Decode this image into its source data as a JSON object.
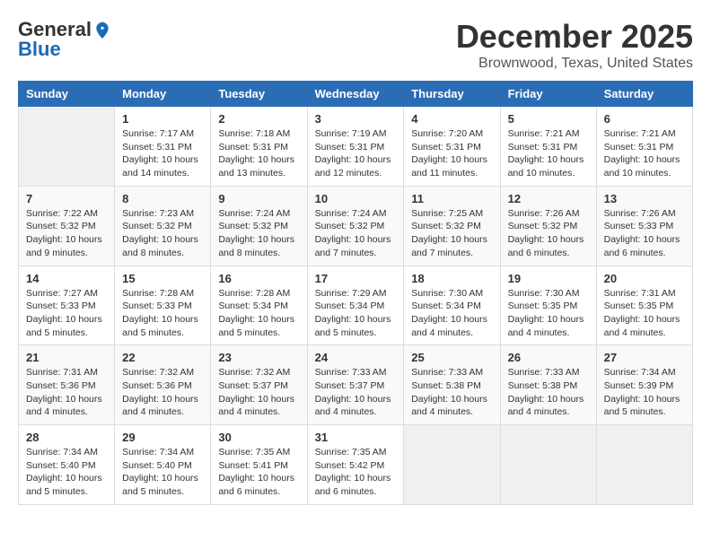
{
  "logo": {
    "general": "General",
    "blue": "Blue"
  },
  "title": {
    "month": "December 2025",
    "location": "Brownwood, Texas, United States"
  },
  "headers": [
    "Sunday",
    "Monday",
    "Tuesday",
    "Wednesday",
    "Thursday",
    "Friday",
    "Saturday"
  ],
  "weeks": [
    [
      {
        "day": "",
        "info": ""
      },
      {
        "day": "1",
        "info": "Sunrise: 7:17 AM\nSunset: 5:31 PM\nDaylight: 10 hours\nand 14 minutes."
      },
      {
        "day": "2",
        "info": "Sunrise: 7:18 AM\nSunset: 5:31 PM\nDaylight: 10 hours\nand 13 minutes."
      },
      {
        "day": "3",
        "info": "Sunrise: 7:19 AM\nSunset: 5:31 PM\nDaylight: 10 hours\nand 12 minutes."
      },
      {
        "day": "4",
        "info": "Sunrise: 7:20 AM\nSunset: 5:31 PM\nDaylight: 10 hours\nand 11 minutes."
      },
      {
        "day": "5",
        "info": "Sunrise: 7:21 AM\nSunset: 5:31 PM\nDaylight: 10 hours\nand 10 minutes."
      },
      {
        "day": "6",
        "info": "Sunrise: 7:21 AM\nSunset: 5:31 PM\nDaylight: 10 hours\nand 10 minutes."
      }
    ],
    [
      {
        "day": "7",
        "info": "Sunrise: 7:22 AM\nSunset: 5:32 PM\nDaylight: 10 hours\nand 9 minutes."
      },
      {
        "day": "8",
        "info": "Sunrise: 7:23 AM\nSunset: 5:32 PM\nDaylight: 10 hours\nand 8 minutes."
      },
      {
        "day": "9",
        "info": "Sunrise: 7:24 AM\nSunset: 5:32 PM\nDaylight: 10 hours\nand 8 minutes."
      },
      {
        "day": "10",
        "info": "Sunrise: 7:24 AM\nSunset: 5:32 PM\nDaylight: 10 hours\nand 7 minutes."
      },
      {
        "day": "11",
        "info": "Sunrise: 7:25 AM\nSunset: 5:32 PM\nDaylight: 10 hours\nand 7 minutes."
      },
      {
        "day": "12",
        "info": "Sunrise: 7:26 AM\nSunset: 5:32 PM\nDaylight: 10 hours\nand 6 minutes."
      },
      {
        "day": "13",
        "info": "Sunrise: 7:26 AM\nSunset: 5:33 PM\nDaylight: 10 hours\nand 6 minutes."
      }
    ],
    [
      {
        "day": "14",
        "info": "Sunrise: 7:27 AM\nSunset: 5:33 PM\nDaylight: 10 hours\nand 5 minutes."
      },
      {
        "day": "15",
        "info": "Sunrise: 7:28 AM\nSunset: 5:33 PM\nDaylight: 10 hours\nand 5 minutes."
      },
      {
        "day": "16",
        "info": "Sunrise: 7:28 AM\nSunset: 5:34 PM\nDaylight: 10 hours\nand 5 minutes."
      },
      {
        "day": "17",
        "info": "Sunrise: 7:29 AM\nSunset: 5:34 PM\nDaylight: 10 hours\nand 5 minutes."
      },
      {
        "day": "18",
        "info": "Sunrise: 7:30 AM\nSunset: 5:34 PM\nDaylight: 10 hours\nand 4 minutes."
      },
      {
        "day": "19",
        "info": "Sunrise: 7:30 AM\nSunset: 5:35 PM\nDaylight: 10 hours\nand 4 minutes."
      },
      {
        "day": "20",
        "info": "Sunrise: 7:31 AM\nSunset: 5:35 PM\nDaylight: 10 hours\nand 4 minutes."
      }
    ],
    [
      {
        "day": "21",
        "info": "Sunrise: 7:31 AM\nSunset: 5:36 PM\nDaylight: 10 hours\nand 4 minutes."
      },
      {
        "day": "22",
        "info": "Sunrise: 7:32 AM\nSunset: 5:36 PM\nDaylight: 10 hours\nand 4 minutes."
      },
      {
        "day": "23",
        "info": "Sunrise: 7:32 AM\nSunset: 5:37 PM\nDaylight: 10 hours\nand 4 minutes."
      },
      {
        "day": "24",
        "info": "Sunrise: 7:33 AM\nSunset: 5:37 PM\nDaylight: 10 hours\nand 4 minutes."
      },
      {
        "day": "25",
        "info": "Sunrise: 7:33 AM\nSunset: 5:38 PM\nDaylight: 10 hours\nand 4 minutes."
      },
      {
        "day": "26",
        "info": "Sunrise: 7:33 AM\nSunset: 5:38 PM\nDaylight: 10 hours\nand 4 minutes."
      },
      {
        "day": "27",
        "info": "Sunrise: 7:34 AM\nSunset: 5:39 PM\nDaylight: 10 hours\nand 5 minutes."
      }
    ],
    [
      {
        "day": "28",
        "info": "Sunrise: 7:34 AM\nSunset: 5:40 PM\nDaylight: 10 hours\nand 5 minutes."
      },
      {
        "day": "29",
        "info": "Sunrise: 7:34 AM\nSunset: 5:40 PM\nDaylight: 10 hours\nand 5 minutes."
      },
      {
        "day": "30",
        "info": "Sunrise: 7:35 AM\nSunset: 5:41 PM\nDaylight: 10 hours\nand 6 minutes."
      },
      {
        "day": "31",
        "info": "Sunrise: 7:35 AM\nSunset: 5:42 PM\nDaylight: 10 hours\nand 6 minutes."
      },
      {
        "day": "",
        "info": ""
      },
      {
        "day": "",
        "info": ""
      },
      {
        "day": "",
        "info": ""
      }
    ]
  ]
}
